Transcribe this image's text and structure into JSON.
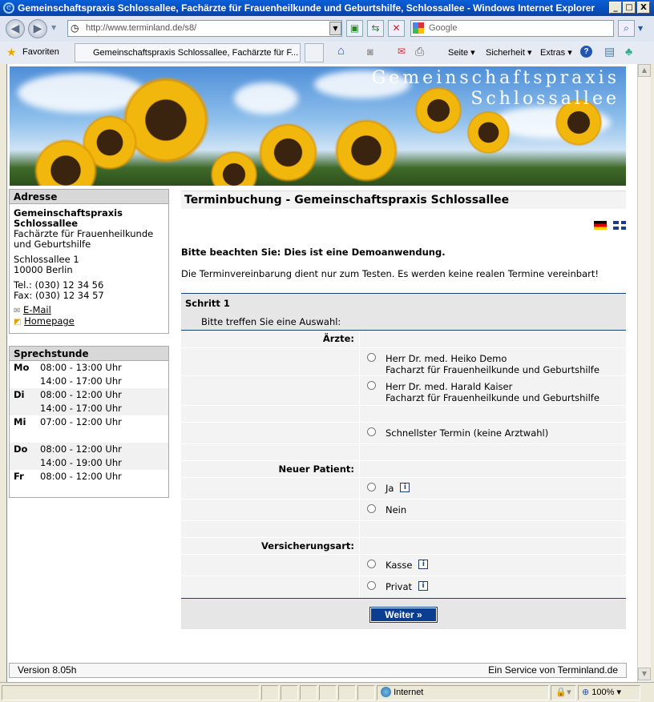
{
  "window": {
    "title": "Gemeinschaftspraxis Schlossallee, Fachärzte für Frauenheilkunde und Geburtshilfe, Schlossallee  - Windows Internet Explorer",
    "min": "_",
    "max": "□",
    "close": "X"
  },
  "nav": {
    "url": "http://www.terminland.de/s8/",
    "search_placeholder": "Google"
  },
  "cmdbar": {
    "favorites": "Favoriten",
    "tab": "Gemeinschaftspraxis Schlossallee, Fachärzte für F...",
    "seite": "Seite ▾",
    "sicherheit": "Sicherheit ▾",
    "extras": "Extras ▾"
  },
  "banner": {
    "line1": "Gemeinschaftspraxis",
    "line2": "Schlossallee"
  },
  "address": {
    "heading": "Adresse",
    "name1": "Gemeinschaftspraxis",
    "name2": "Schlossallee",
    "spec1": "Fachärzte für Frauenheilkunde",
    "spec2": "und Geburtshilfe",
    "street": "Schlossallee 1",
    "city": "10000 Berlin",
    "tel": "Tel.: (030) 12 34 56",
    "fax": "Fax: (030) 12 34 57",
    "email": "E-Mail",
    "homepage": "Homepage"
  },
  "hours": {
    "heading": "Sprechstunde",
    "rows": [
      {
        "day": "Mo",
        "time": "08:00 - 13:00 Uhr"
      },
      {
        "day": "",
        "time": "14:00 - 17:00 Uhr"
      },
      {
        "day": "Di",
        "time": "08:00 - 12:00 Uhr"
      },
      {
        "day": "",
        "time": "14:00 - 17:00 Uhr"
      },
      {
        "day": "Mi",
        "time": "07:00 - 12:00 Uhr"
      },
      {
        "day": "",
        "time": ""
      },
      {
        "day": "Do",
        "time": "08:00 - 12:00 Uhr"
      },
      {
        "day": "",
        "time": "14:00 - 19:00 Uhr"
      },
      {
        "day": "Fr",
        "time": "08:00 - 12:00 Uhr"
      }
    ]
  },
  "main": {
    "title": "Terminbuchung - Gemeinschaftspraxis Schlossallee",
    "notice": "Bitte beachten Sie: Dies ist eine Demoanwendung.",
    "info": "Die Terminvereinbarung dient nur zum Testen. Es werden keine realen Termine vereinbart!"
  },
  "form": {
    "step": "Schritt 1",
    "instruction": "Bitte treffen Sie eine Auswahl:",
    "aerzte_label": "Ärzte:",
    "doc1_name": "Herr Dr. med. Heiko Demo",
    "doc1_spec": "Facharzt für Frauenheilkunde und Geburtshilfe",
    "doc2_name": "Herr Dr. med. Harald Kaiser",
    "doc2_spec": "Facharzt für Frauenheilkunde und Geburtshilfe",
    "fastest": "Schnellster Termin (keine Arztwahl)",
    "patient_label": "Neuer Patient:",
    "ja": "Ja",
    "nein": "Nein",
    "insurance_label": "Versicherungsart:",
    "kasse": "Kasse",
    "privat": "Privat",
    "info_glyph": "i",
    "submit": "Weiter »"
  },
  "footer": {
    "version": "Version 8.05h",
    "service": "Ein Service von Terminland.de"
  },
  "status": {
    "zone": "Internet",
    "zoom": "100%"
  }
}
